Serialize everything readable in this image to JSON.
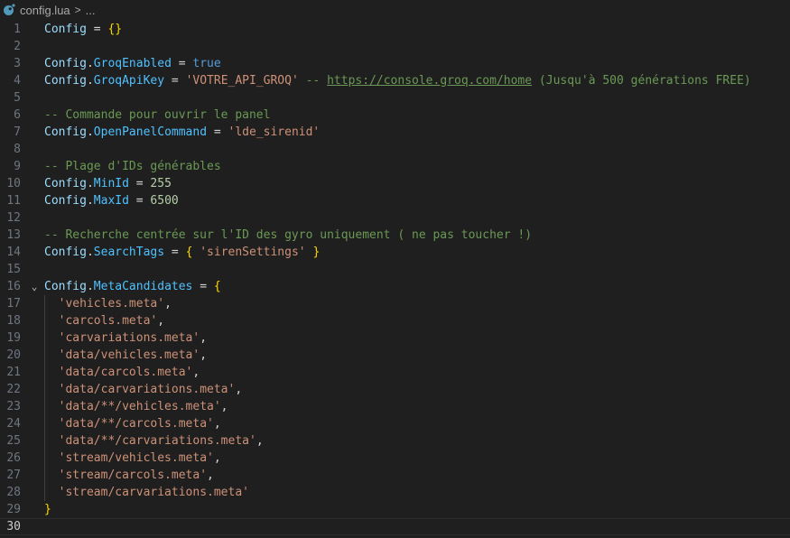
{
  "breadcrumb": {
    "file": "config.lua",
    "separator": ">",
    "more": "..."
  },
  "lines": [
    {
      "n": "1",
      "tokens": [
        [
          "v",
          "Config"
        ],
        [
          "op",
          " = "
        ],
        [
          "br",
          "{}"
        ]
      ]
    },
    {
      "n": "2",
      "tokens": []
    },
    {
      "n": "3",
      "tokens": [
        [
          "v",
          "Config"
        ],
        [
          "op",
          "."
        ],
        [
          "p",
          "GroqEnabled"
        ],
        [
          "op",
          " = "
        ],
        [
          "k",
          "true"
        ]
      ]
    },
    {
      "n": "4",
      "tokens": [
        [
          "v",
          "Config"
        ],
        [
          "op",
          "."
        ],
        [
          "p",
          "GroqApiKey"
        ],
        [
          "op",
          " = "
        ],
        [
          "s",
          "'VOTRE_API_GROQ'"
        ],
        [
          "c",
          " -- "
        ],
        [
          "url",
          "https://console.groq.com/home"
        ],
        [
          "c",
          " (Jusqu'à 500 générations FREE)"
        ]
      ]
    },
    {
      "n": "5",
      "tokens": []
    },
    {
      "n": "6",
      "tokens": [
        [
          "c",
          "-- Commande pour ouvrir le panel"
        ]
      ]
    },
    {
      "n": "7",
      "tokens": [
        [
          "v",
          "Config"
        ],
        [
          "op",
          "."
        ],
        [
          "p",
          "OpenPanelCommand"
        ],
        [
          "op",
          " = "
        ],
        [
          "s",
          "'lde_sirenid'"
        ]
      ]
    },
    {
      "n": "8",
      "tokens": []
    },
    {
      "n": "9",
      "tokens": [
        [
          "c",
          "-- Plage d'IDs générables"
        ]
      ]
    },
    {
      "n": "10",
      "tokens": [
        [
          "v",
          "Config"
        ],
        [
          "op",
          "."
        ],
        [
          "p",
          "MinId"
        ],
        [
          "op",
          " = "
        ],
        [
          "n",
          "255"
        ]
      ]
    },
    {
      "n": "11",
      "tokens": [
        [
          "v",
          "Config"
        ],
        [
          "op",
          "."
        ],
        [
          "p",
          "MaxId"
        ],
        [
          "op",
          " = "
        ],
        [
          "n",
          "6500"
        ]
      ]
    },
    {
      "n": "12",
      "tokens": []
    },
    {
      "n": "13",
      "tokens": [
        [
          "c",
          "-- Recherche centrée sur l'ID des gyro uniquement ( ne pas toucher !)"
        ]
      ]
    },
    {
      "n": "14",
      "tokens": [
        [
          "v",
          "Config"
        ],
        [
          "op",
          "."
        ],
        [
          "p",
          "SearchTags"
        ],
        [
          "op",
          " = "
        ],
        [
          "br",
          "{"
        ],
        [
          "op",
          " "
        ],
        [
          "s",
          "'sirenSettings'"
        ],
        [
          "op",
          " "
        ],
        [
          "br",
          "}"
        ]
      ]
    },
    {
      "n": "15",
      "tokens": []
    },
    {
      "n": "16",
      "tokens": [
        [
          "v",
          "Config"
        ],
        [
          "op",
          "."
        ],
        [
          "p",
          "MetaCandidates"
        ],
        [
          "op",
          " = "
        ],
        [
          "br",
          "{"
        ]
      ],
      "fold": "⌄"
    },
    {
      "n": "17",
      "tokens": [
        [
          "op",
          "  "
        ],
        [
          "s",
          "'vehicles.meta'"
        ],
        [
          "op",
          ","
        ]
      ]
    },
    {
      "n": "18",
      "tokens": [
        [
          "op",
          "  "
        ],
        [
          "s",
          "'carcols.meta'"
        ],
        [
          "op",
          ","
        ]
      ]
    },
    {
      "n": "19",
      "tokens": [
        [
          "op",
          "  "
        ],
        [
          "s",
          "'carvariations.meta'"
        ],
        [
          "op",
          ","
        ]
      ]
    },
    {
      "n": "20",
      "tokens": [
        [
          "op",
          "  "
        ],
        [
          "s",
          "'data/vehicles.meta'"
        ],
        [
          "op",
          ","
        ]
      ]
    },
    {
      "n": "21",
      "tokens": [
        [
          "op",
          "  "
        ],
        [
          "s",
          "'data/carcols.meta'"
        ],
        [
          "op",
          ","
        ]
      ]
    },
    {
      "n": "22",
      "tokens": [
        [
          "op",
          "  "
        ],
        [
          "s",
          "'data/carvariations.meta'"
        ],
        [
          "op",
          ","
        ]
      ]
    },
    {
      "n": "23",
      "tokens": [
        [
          "op",
          "  "
        ],
        [
          "s",
          "'data/**/vehicles.meta'"
        ],
        [
          "op",
          ","
        ]
      ]
    },
    {
      "n": "24",
      "tokens": [
        [
          "op",
          "  "
        ],
        [
          "s",
          "'data/**/carcols.meta'"
        ],
        [
          "op",
          ","
        ]
      ]
    },
    {
      "n": "25",
      "tokens": [
        [
          "op",
          "  "
        ],
        [
          "s",
          "'data/**/carvariations.meta'"
        ],
        [
          "op",
          ","
        ]
      ]
    },
    {
      "n": "26",
      "tokens": [
        [
          "op",
          "  "
        ],
        [
          "s",
          "'stream/vehicles.meta'"
        ],
        [
          "op",
          ","
        ]
      ]
    },
    {
      "n": "27",
      "tokens": [
        [
          "op",
          "  "
        ],
        [
          "s",
          "'stream/carcols.meta'"
        ],
        [
          "op",
          ","
        ]
      ]
    },
    {
      "n": "28",
      "tokens": [
        [
          "op",
          "  "
        ],
        [
          "s",
          "'stream/carvariations.meta'"
        ]
      ]
    },
    {
      "n": "29",
      "tokens": [
        [
          "br",
          "}"
        ]
      ]
    },
    {
      "n": "30",
      "tokens": [],
      "current": true
    }
  ],
  "colors": {
    "background": "#1f1f1f",
    "comment": "#6a9955",
    "string": "#ce9178",
    "property": "#4fc1ff",
    "variable": "#9cdcfe",
    "number": "#b5cea8",
    "keyword": "#569cd6",
    "bracket": "#ffd700"
  },
  "icons": {
    "file": "lua-file-icon",
    "fold": "chevron-down-icon"
  }
}
